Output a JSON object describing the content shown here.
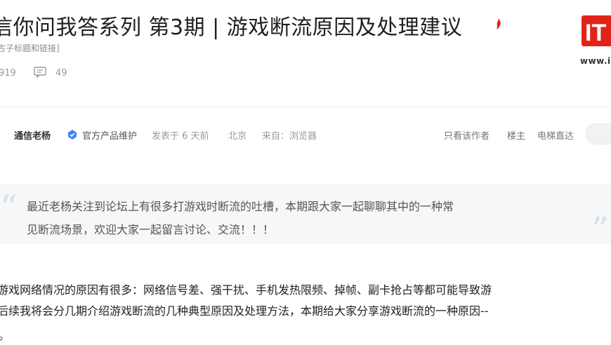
{
  "header": {
    "title": "信你问我答系列 第3期 | 游戏断流原因及处理建议",
    "subtitle": "古子标题和链接]",
    "views": "919",
    "comments": "49"
  },
  "logo": {
    "mark": "IT",
    "site_partial": "www.i"
  },
  "post_meta": {
    "author": "通信老杨",
    "role": "官方产品维护",
    "time": "发表于 6 天前",
    "location": "北京",
    "source": "来自：浏览器",
    "only_author": "只看该作者",
    "floor_main": "楼主",
    "elevator": "电梯直达"
  },
  "quote": {
    "line1": "最近老杨关注到论坛上有很多打游戏时断流的吐槽，本期跟大家一起聊聊其中的一种常",
    "line2": "见断流场景，欢迎大家一起留言讨论、交流！！！"
  },
  "content": {
    "line1": "游戏网络情况的原因有很多：网络信号差、强干扰、手机发热限频、掉帧、副卡抢占等都可能导致游",
    "line2": "后续我将会分几期介绍游戏断流的几种典型原因及处理方法，本期给大家分享游戏断流的一种原因--",
    "line3": "。"
  },
  "colors": {
    "accent_red": "#e2231a",
    "verify_blue": "#3b82f6",
    "quote_bg": "#f6f7f9"
  }
}
